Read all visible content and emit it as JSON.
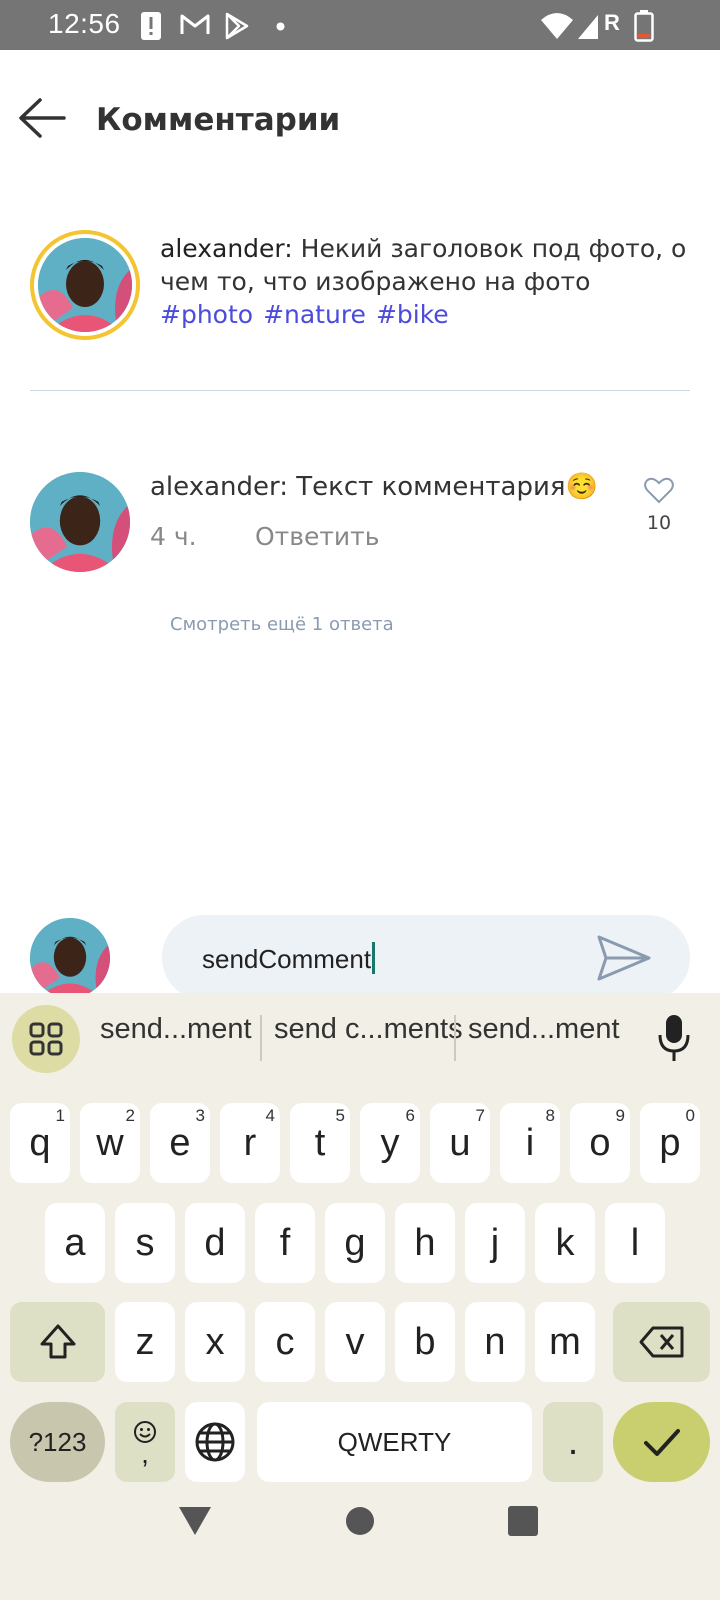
{
  "status_bar": {
    "time": "12:56",
    "icons": [
      "alert-icon",
      "gmail-icon",
      "play-store-icon",
      "dot-icon",
      "wifi-icon",
      "signal-icon",
      "roaming-r-icon",
      "battery-icon"
    ],
    "roaming_label": "R"
  },
  "header": {
    "title": "Комментарии"
  },
  "post": {
    "username": "alexander:",
    "caption": "Некий заголовок под фото, о чем то, что изображено на фото",
    "hashtags": [
      "#photo",
      "#nature",
      "#bike"
    ],
    "ring_color": "#f4c431"
  },
  "comment": {
    "username": "alexander:",
    "text": "Текст комментария☺️",
    "time": "4 ч.",
    "reply_label": "Ответить",
    "likes": "10",
    "more_replies": "Смотреть ещё 1 ответа"
  },
  "composer": {
    "value": "sendComment"
  },
  "keyboard": {
    "suggestions": [
      "send...ment",
      "send c...ments",
      "send...ment"
    ],
    "row1": [
      {
        "k": "q",
        "n": "1"
      },
      {
        "k": "w",
        "n": "2"
      },
      {
        "k": "e",
        "n": "3"
      },
      {
        "k": "r",
        "n": "4"
      },
      {
        "k": "t",
        "n": "5"
      },
      {
        "k": "y",
        "n": "6"
      },
      {
        "k": "u",
        "n": "7"
      },
      {
        "k": "i",
        "n": "8"
      },
      {
        "k": "o",
        "n": "9"
      },
      {
        "k": "p",
        "n": "0"
      }
    ],
    "row2": [
      "a",
      "s",
      "d",
      "f",
      "g",
      "h",
      "j",
      "k",
      "l"
    ],
    "row3": [
      "z",
      "x",
      "c",
      "v",
      "b",
      "n",
      "m"
    ],
    "symbols_label": "?123",
    "emoji_comma_label": ",",
    "space_label": "QWERTY",
    "period_label": ".",
    "accent_color": "#c9cf6f"
  }
}
